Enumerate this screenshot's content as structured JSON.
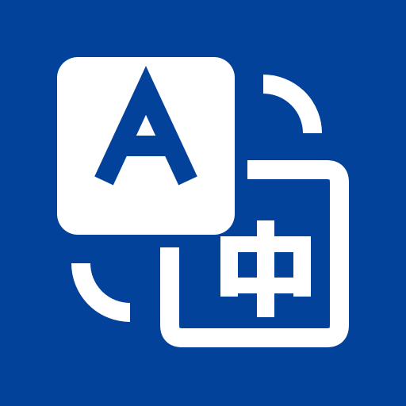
{
  "icon": {
    "name": "translate-app-icon",
    "background_color": "#03429A",
    "foreground_color": "#FFFFFF",
    "source_glyph": "A",
    "target_glyph": "中"
  }
}
